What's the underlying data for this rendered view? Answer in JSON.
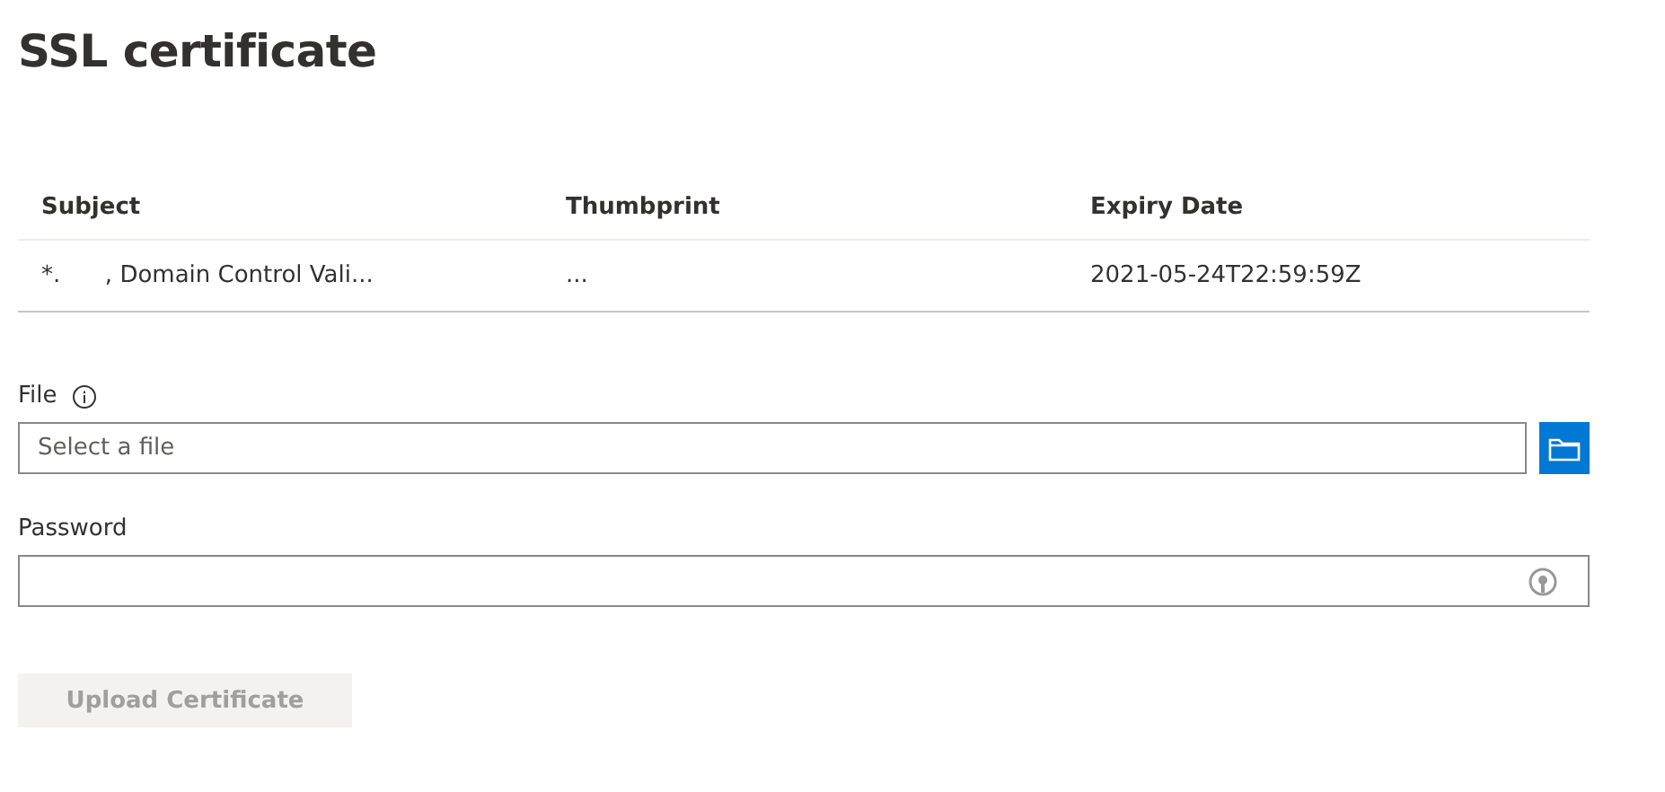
{
  "title": "SSL certificate",
  "table": {
    "columns": [
      "Subject",
      "Thumbprint",
      "Expiry Date"
    ],
    "rows": [
      {
        "cells": [
          "*.      , Domain Control Vali...",
          "...",
          "2021-05-24T22:59:59Z"
        ]
      }
    ]
  },
  "file": {
    "label": "File",
    "placeholder": "Select a file"
  },
  "password": {
    "label": "Password"
  },
  "upload_button": {
    "label": "Upload Certificate",
    "disabled": true
  }
}
